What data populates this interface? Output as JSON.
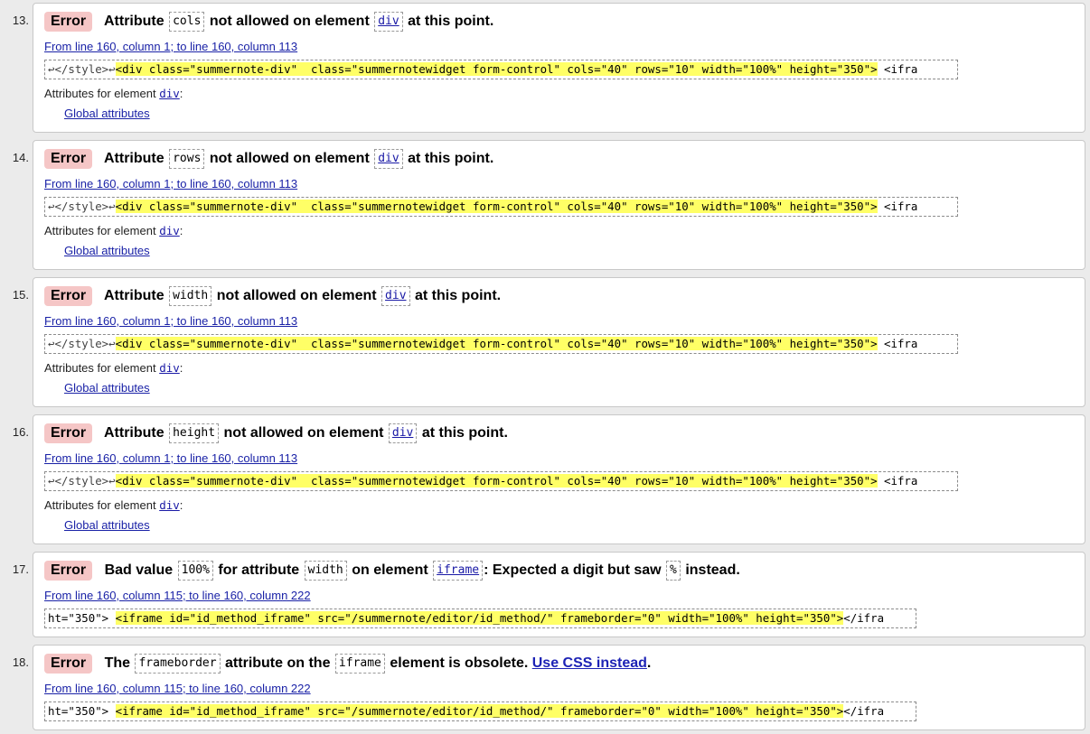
{
  "labels": {
    "error_badge": "Error",
    "attributes_for_element": "Attributes for element",
    "global_attributes": "Global attributes"
  },
  "colors": {
    "error_badge_bg": "#f5c6c6",
    "highlight": "#ffff66",
    "link": "#1a22a7"
  },
  "messages": [
    {
      "number": "13.",
      "parts": [
        "Attribute",
        "cols",
        "not allowed on element",
        "div",
        "at this point."
      ],
      "location": "From line 160, column 1; to line 160, column 113",
      "extract_pre": "↩</style>↩",
      "extract_hl": "<div class=\"summernote-div\"  class=\"summernotewidget form-control\" cols=\"40\" rows=\"10\" width=\"100%\" height=\"350\">",
      "extract_post": " <ifra",
      "attr_element": "div"
    },
    {
      "number": "14.",
      "parts": [
        "Attribute",
        "rows",
        "not allowed on element",
        "div",
        "at this point."
      ],
      "location": "From line 160, column 1; to line 160, column 113",
      "extract_pre": "↩</style>↩",
      "extract_hl": "<div class=\"summernote-div\"  class=\"summernotewidget form-control\" cols=\"40\" rows=\"10\" width=\"100%\" height=\"350\">",
      "extract_post": " <ifra",
      "attr_element": "div"
    },
    {
      "number": "15.",
      "parts": [
        "Attribute",
        "width",
        "not allowed on element",
        "div",
        "at this point."
      ],
      "location": "From line 160, column 1; to line 160, column 113",
      "extract_pre": "↩</style>↩",
      "extract_hl": "<div class=\"summernote-div\"  class=\"summernotewidget form-control\" cols=\"40\" rows=\"10\" width=\"100%\" height=\"350\">",
      "extract_post": " <ifra",
      "attr_element": "div"
    },
    {
      "number": "16.",
      "parts": [
        "Attribute",
        "height",
        "not allowed on element",
        "div",
        "at this point."
      ],
      "location": "From line 160, column 1; to line 160, column 113",
      "extract_pre": "↩</style>↩",
      "extract_hl": "<div class=\"summernote-div\"  class=\"summernotewidget form-control\" cols=\"40\" rows=\"10\" width=\"100%\" height=\"350\">",
      "extract_post": " <ifra",
      "attr_element": "div"
    },
    {
      "number": "17.",
      "parts": [
        "Bad value",
        "100%",
        "for attribute",
        "width",
        "on element",
        "iframe",
        ": Expected a digit but saw",
        "%",
        "instead."
      ],
      "location": "From line 160, column 115; to line 160, column 222",
      "extract_pre": "ht=\"350\"> ",
      "extract_hl": "<iframe id=\"id_method_iframe\" src=\"/summernote/editor/id_method/\" frameborder=\"0\" width=\"100%\" height=\"350\">",
      "extract_post": "</ifra"
    },
    {
      "number": "18.",
      "parts": [
        "The",
        "frameborder",
        "attribute on the",
        "iframe",
        "element is obsolete.",
        "Use CSS instead",
        "."
      ],
      "location": "From line 160, column 115; to line 160, column 222",
      "extract_pre": "ht=\"350\"> ",
      "extract_hl": "<iframe id=\"id_method_iframe\" src=\"/summernote/editor/id_method/\" frameborder=\"0\" width=\"100%\" height=\"350\">",
      "extract_post": "</ifra"
    }
  ]
}
